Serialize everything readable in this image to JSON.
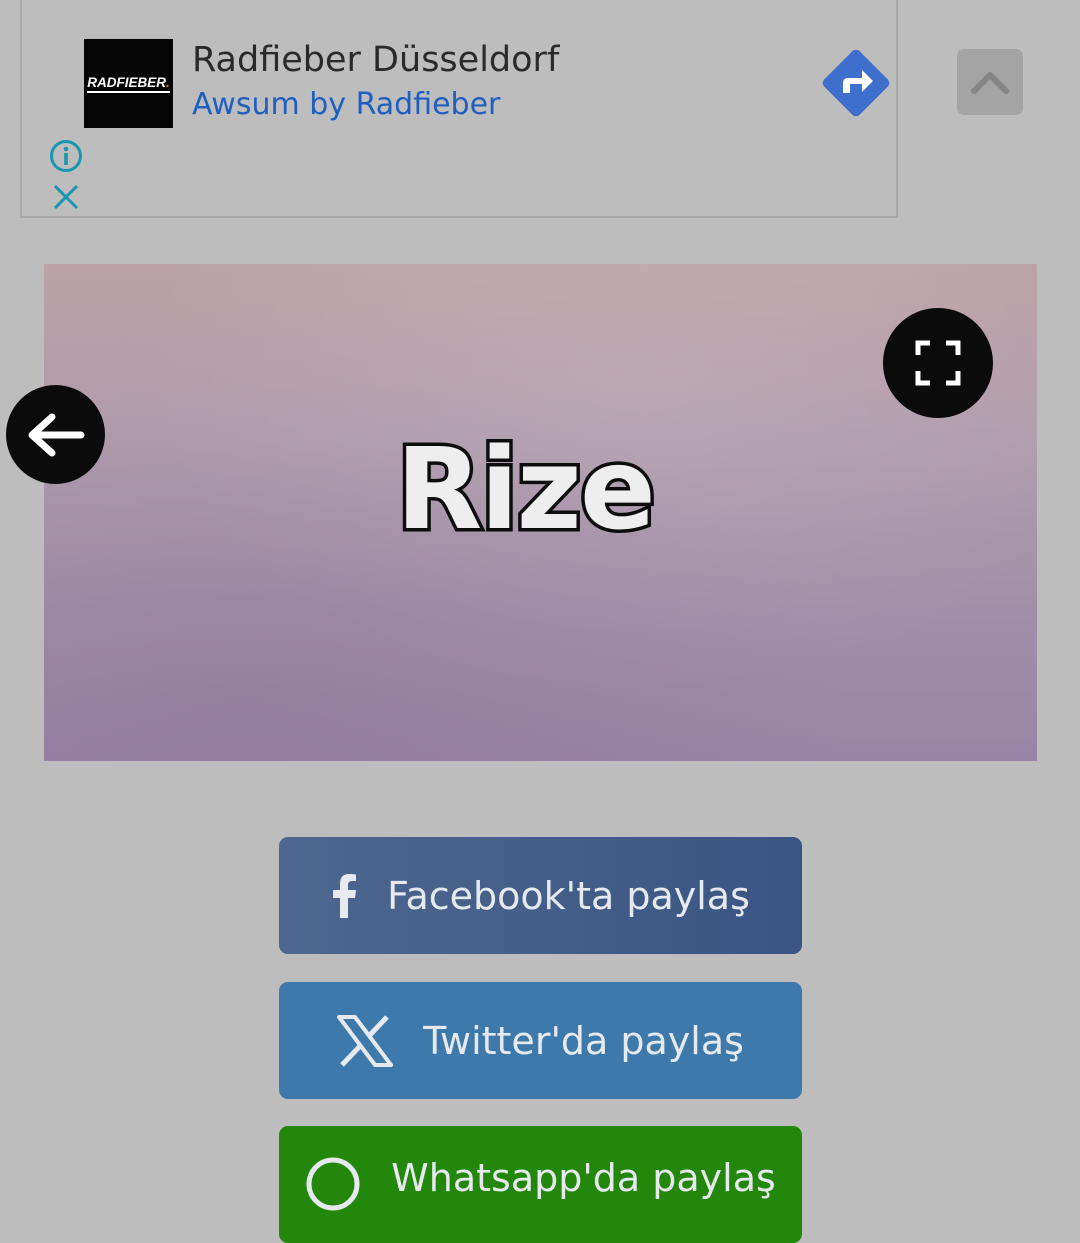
{
  "ad": {
    "logo_text_part1": "RADFIEBER",
    "logo_text_part2": ".",
    "title": "Radfieber Düsseldorf",
    "subtitle": "Awsum by Radfieber",
    "icons": {
      "directions": "directions-icon",
      "info": "info-icon",
      "close": "close-icon"
    },
    "colors": {
      "subtitle": "#1f5fc0",
      "directions": "#3f6fcc",
      "info_close": "#1a96b0"
    }
  },
  "scroll_top": {
    "icon": "chevron-up-icon"
  },
  "hero": {
    "title": "Rize",
    "fullscreen_icon": "fullscreen-icon",
    "back_icon": "arrow-left-icon"
  },
  "share": {
    "facebook_label": "Facebook'ta paylaş",
    "twitter_label": "Twitter'da paylaş",
    "whatsapp_label": "Whatsapp'da paylaş",
    "colors": {
      "facebook": "#3a5584",
      "twitter": "#3d79ab",
      "whatsapp": "#22870a"
    }
  }
}
